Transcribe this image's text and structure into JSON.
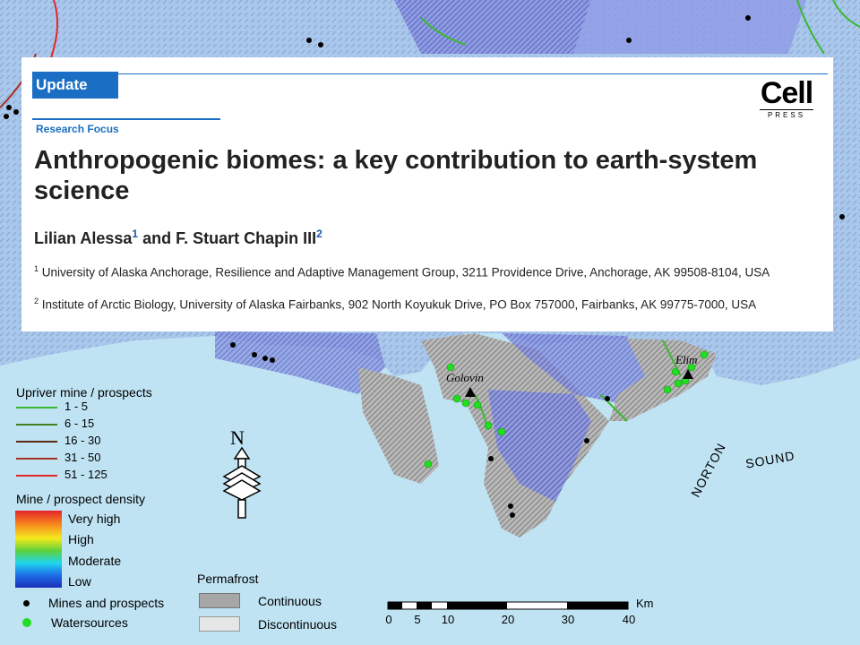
{
  "paper": {
    "update_label": "Update",
    "research_focus": "Research Focus",
    "title": "Anthropogenic biomes: a key contribution to earth-system science",
    "author1": "Lilian Alessa",
    "author1_sup": "1",
    "author_and": " and F. Stuart Chapin III",
    "author2_sup": "2",
    "affiliation1_sup": "1",
    "affiliation1": "University of Alaska Anchorage, Resilience and Adaptive Management Group, 3211 Providence Drive, Anchorage, AK 99508-8104, USA",
    "affiliation2_sup": "2",
    "affiliation2": "Institute of Arctic Biology, University of Alaska Fairbanks, 902 North Koyukuk Drive, PO Box 757000, Fairbanks, AK 99775-7000, USA",
    "logo_text": "Cell",
    "logo_subtext": "PRESS"
  },
  "map_labels": {
    "golovin": "Golovin",
    "elim": "Elim",
    "norton": "NORTON",
    "sound": "SOUND"
  },
  "legend": {
    "mines_title": "Upriver mine / prospects",
    "mine_classes": [
      {
        "label": "1 - 5",
        "color": "#3cb830"
      },
      {
        "label": "6 - 15",
        "color": "#3f7f1d"
      },
      {
        "label": "16 - 30",
        "color": "#5a2a14"
      },
      {
        "label": "31 - 50",
        "color": "#a83222"
      },
      {
        "label": "51 - 125",
        "color": "#e3262a"
      }
    ],
    "density_title": "Mine / prospect density",
    "density_levels": [
      "Very high",
      "High",
      "Moderate",
      "Low"
    ],
    "mines_and_prospects": "Mines and prospects",
    "watersources": "Watersources",
    "permafrost_title": "Permafrost",
    "permafrost_continuous": "Continuous",
    "permafrost_discontinuous": "Discontinuous"
  },
  "scale_bar": {
    "unit": "Km",
    "ticks": [
      "0",
      "5",
      "10",
      "20",
      "30",
      "40"
    ]
  },
  "north_label": "N",
  "colors": {
    "ocean": "#bfe3f3",
    "land_low_density": "#a9c5ea",
    "land_moderate_density": "#7f8ee6",
    "permafrost_continuous": "#a6a6a6",
    "permafrost_discontinuous": "#e6e6e6",
    "journal_blue": "#1a6fc4",
    "watersource": "#22dd22"
  }
}
